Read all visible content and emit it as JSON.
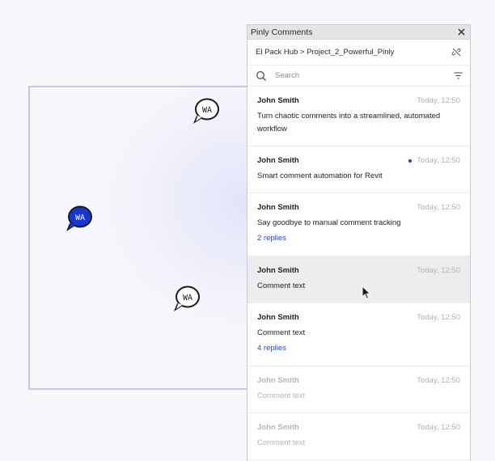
{
  "panel": {
    "title": "Pinly Comments",
    "close_icon": "close-icon",
    "breadcrumb": "El Pack Hub > Project_2_Powerful_Pinly",
    "unlink_icon": "unlink-icon",
    "search": {
      "placeholder": "Search",
      "value": ""
    },
    "filter_icon": "filter-icon"
  },
  "comments": [
    {
      "author": "John Smith",
      "time": "Today, 12:50",
      "text": "Turn chaotic comments into a streamlined, automated workflow",
      "replies": "",
      "unread": false,
      "dim": false
    },
    {
      "author": "John Smith",
      "time": "Today, 12:50",
      "text": "Smart comment automation for Revit",
      "replies": "",
      "unread": true,
      "dim": false
    },
    {
      "author": "John Smith",
      "time": "Today, 12:50",
      "text": "Say goodbye to manual comment tracking",
      "replies": "2 replies",
      "unread": false,
      "dim": false
    },
    {
      "author": "John Smith",
      "time": "Today, 12:50",
      "text": "Comment text",
      "replies": "",
      "unread": false,
      "dim": false,
      "hovered": true
    },
    {
      "author": "John Smith",
      "time": "Today, 12:50",
      "text": "Comment text",
      "replies": "4 replies",
      "unread": false,
      "dim": false
    },
    {
      "author": "John Smith",
      "time": "Today, 12:50",
      "text": "Comment text",
      "replies": "",
      "unread": false,
      "dim": true
    },
    {
      "author": "John Smith",
      "time": "Today, 12:50",
      "text": "Comment text",
      "replies": "",
      "unread": false,
      "dim": true
    }
  ],
  "pins": [
    {
      "label": "WA",
      "style": "outline"
    },
    {
      "label": "WA",
      "style": "filled"
    },
    {
      "label": "WA",
      "style": "outline"
    }
  ],
  "colors": {
    "accent": "#2a4bd1",
    "unread_dot": "#1d3fcf",
    "pin_filled": "#1537d8",
    "frame_border": "#c4c5ec"
  }
}
